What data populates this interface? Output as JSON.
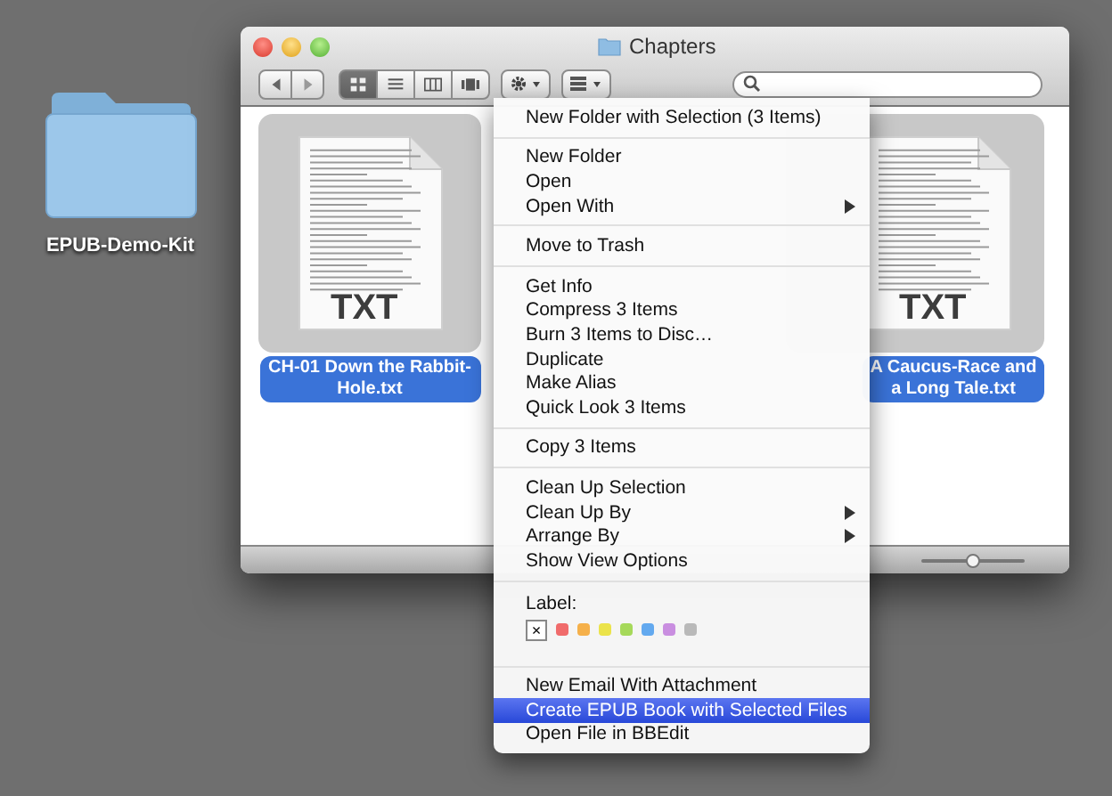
{
  "desktop_icon": {
    "label": "EPUB-Demo-Kit"
  },
  "window": {
    "title": "Chapters",
    "view_buttons": [
      {
        "selected": true
      },
      {
        "selected": false
      },
      {
        "selected": false
      },
      {
        "selected": false
      }
    ],
    "files": [
      {
        "name": "CH-01 Down the Rabbit-Hole.txt",
        "type_label": "TXT",
        "selected": true
      },
      {
        "name": "A Caucus-Race and a Long Tale.txt",
        "type_label": "TXT",
        "selected": true
      }
    ],
    "zoom_slider": {
      "level": 0.5
    }
  },
  "context_menu": {
    "sections": [
      {
        "kind": "items",
        "items": [
          {
            "label": "New Folder with Selection (3 Items)",
            "submenu": false,
            "selected": false
          }
        ]
      },
      {
        "kind": "items",
        "items": [
          {
            "label": "New Folder",
            "submenu": false,
            "selected": false
          },
          {
            "label": "Open",
            "submenu": false,
            "selected": false
          },
          {
            "label": "Open With",
            "submenu": true,
            "selected": false
          }
        ]
      },
      {
        "kind": "items",
        "items": [
          {
            "label": "Move to Trash",
            "submenu": false,
            "selected": false
          }
        ]
      },
      {
        "kind": "items",
        "items": [
          {
            "label": "Get Info",
            "submenu": false,
            "selected": false
          },
          {
            "label": "Compress 3 Items",
            "submenu": false,
            "selected": false
          },
          {
            "label": "Burn 3 Items to Disc…",
            "submenu": false,
            "selected": false
          },
          {
            "label": "Duplicate",
            "submenu": false,
            "selected": false
          },
          {
            "label": "Make Alias",
            "submenu": false,
            "selected": false
          },
          {
            "label": "Quick Look 3 Items",
            "submenu": false,
            "selected": false
          }
        ]
      },
      {
        "kind": "items",
        "items": [
          {
            "label": "Copy 3 Items",
            "submenu": false,
            "selected": false
          }
        ]
      },
      {
        "kind": "items",
        "items": [
          {
            "label": "Clean Up Selection",
            "submenu": false,
            "selected": false
          },
          {
            "label": "Clean Up By",
            "submenu": true,
            "selected": false
          },
          {
            "label": "Arrange By",
            "submenu": true,
            "selected": false
          },
          {
            "label": "Show View Options",
            "submenu": false,
            "selected": false
          }
        ]
      },
      {
        "kind": "labels",
        "title": "Label:",
        "none_mark": "×",
        "swatches": [
          {
            "color": "#f06b6b"
          },
          {
            "color": "#f5b04a"
          },
          {
            "color": "#ebe34a"
          },
          {
            "color": "#a6d95a"
          },
          {
            "color": "#63a9ef"
          },
          {
            "color": "#c98ee0"
          },
          {
            "color": "#b9b9b9"
          }
        ]
      },
      {
        "kind": "items",
        "items": [
          {
            "label": "New Email With Attachment",
            "submenu": false,
            "selected": false
          },
          {
            "label": "Create EPUB Book with Selected Files",
            "submenu": false,
            "selected": true
          },
          {
            "label": "Open File in BBEdit",
            "submenu": false,
            "selected": false
          }
        ]
      }
    ]
  }
}
